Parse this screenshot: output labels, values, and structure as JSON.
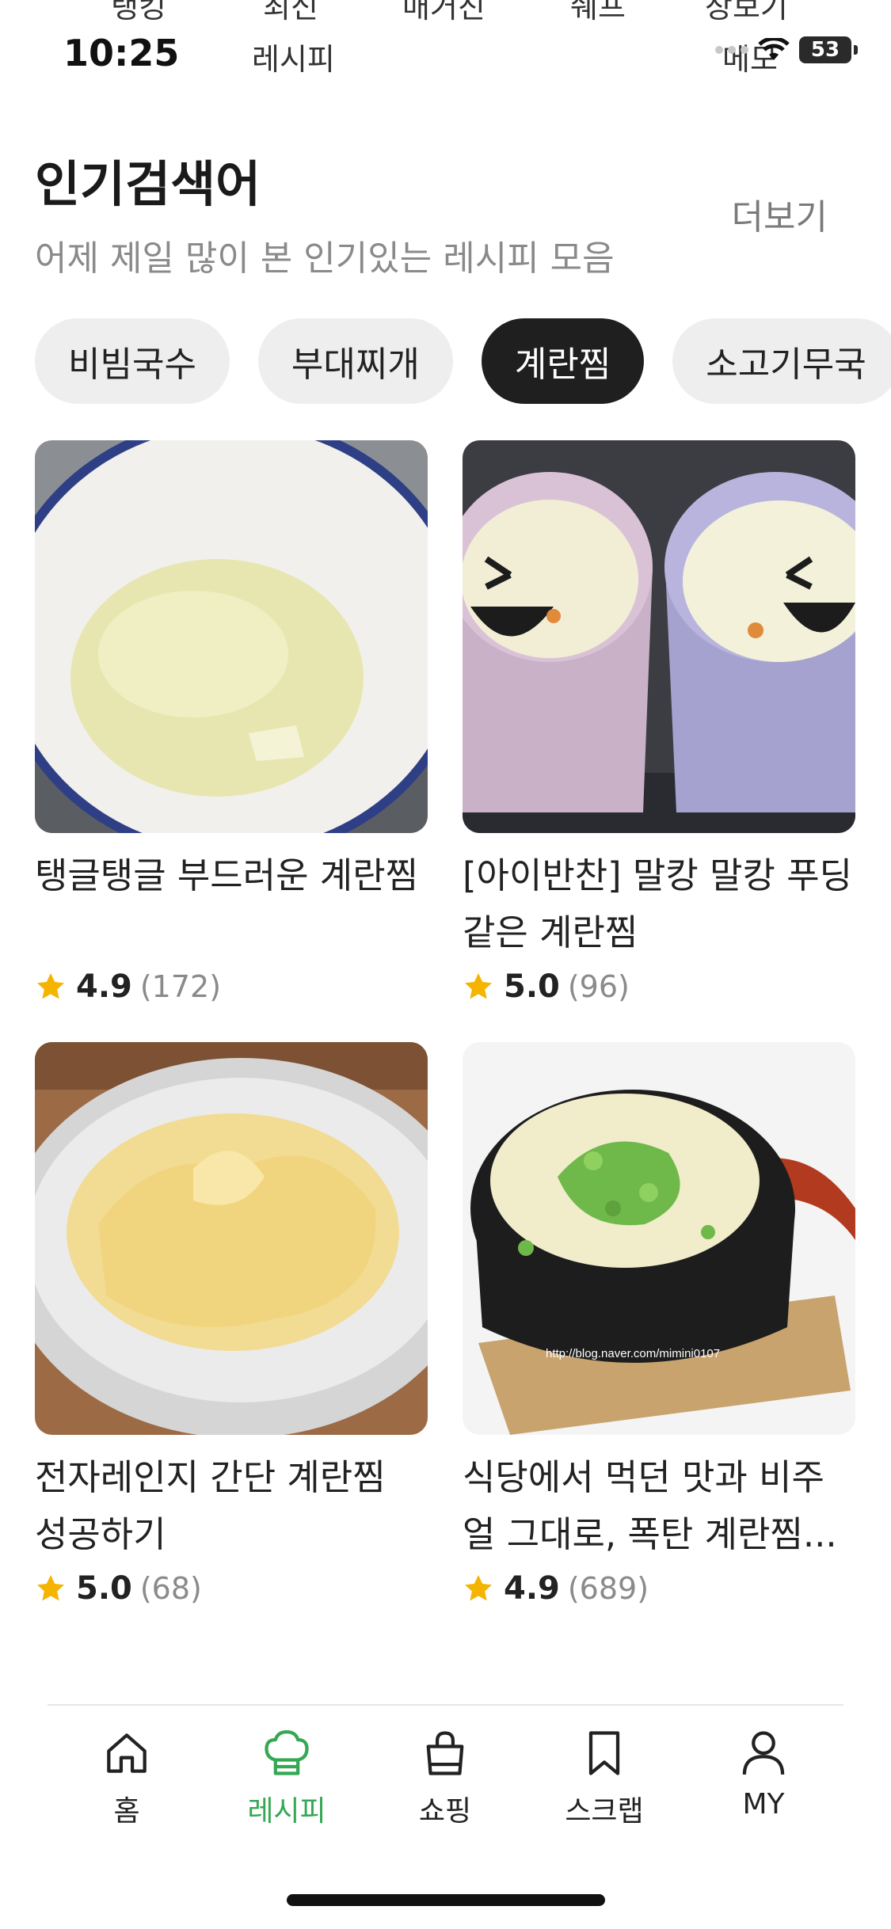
{
  "status_bar": {
    "time": "10:25",
    "battery": "53"
  },
  "top_tabs": [
    "랭킹",
    "최신",
    "매거진",
    "쉐프",
    "장보기"
  ],
  "top_tabs_sub": [
    "레시피",
    "메모"
  ],
  "section": {
    "title": "인기검색어",
    "subtitle": "어제 제일 많이 본 인기있는 레시피 모음",
    "more_label": "더보기"
  },
  "chips": [
    {
      "label": "비빔국수",
      "active": false
    },
    {
      "label": "부대찌개",
      "active": false
    },
    {
      "label": "계란찜",
      "active": true
    },
    {
      "label": "소고기무국",
      "active": false
    }
  ],
  "recipes": [
    {
      "title": "탱글탱글 부드러운 계란찜",
      "rating": "4.9",
      "count": "(172)"
    },
    {
      "title": "[아이반찬] 말캉 말캉 푸딩같은 계란찜",
      "rating": "5.0",
      "count": "(96)"
    },
    {
      "title": "전자레인지 간단 계란찜 성공하기",
      "rating": "5.0",
      "count": "(68)"
    },
    {
      "title": "식당에서 먹던 맛과 비주얼 그대로, 폭탄 계란찜...",
      "rating": "4.9",
      "count": "(689)"
    }
  ],
  "image_watermark": "http://blog.naver.com/mimini0107",
  "bottom_nav": [
    {
      "label": "홈",
      "icon": "home-icon",
      "active": false
    },
    {
      "label": "레시피",
      "icon": "chef-hat-icon",
      "active": true
    },
    {
      "label": "쇼핑",
      "icon": "shopping-bag-icon",
      "active": false
    },
    {
      "label": "스크랩",
      "icon": "bookmark-icon",
      "active": false
    },
    {
      "label": "MY",
      "icon": "user-icon",
      "active": false
    }
  ],
  "colors": {
    "accent": "#34a853",
    "chip_active": "#1f1f1f",
    "star": "#f5b400"
  }
}
